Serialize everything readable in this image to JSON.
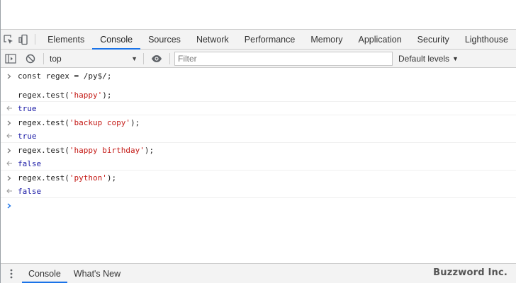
{
  "devtools": {
    "tabs": [
      "Elements",
      "Console",
      "Sources",
      "Network",
      "Performance",
      "Memory",
      "Application",
      "Security",
      "Lighthouse"
    ],
    "active_tab": "Console"
  },
  "toolbar": {
    "context_value": "top",
    "filter_placeholder": "Filter",
    "levels_label": "Default levels"
  },
  "console": {
    "input1_line1_code": "const regex = /py$/;",
    "input1_line2_prefix": "regex.test(",
    "input1_line2_arg": "'happy'",
    "input1_line2_suffix": ");",
    "result1": "true",
    "input2_prefix": "regex.test(",
    "input2_arg": "'backup copy'",
    "input2_suffix": ");",
    "result2": "true",
    "input3_prefix": "regex.test(",
    "input3_arg": "'happy birthday'",
    "input3_suffix": ");",
    "result3": "false",
    "input4_prefix": "regex.test(",
    "input4_arg": "'python'",
    "input4_suffix": ");",
    "result4": "false"
  },
  "drawer": {
    "tabs": [
      "Console",
      "What's New"
    ],
    "active_tab": "Console"
  },
  "watermark": "Buzzword Inc.",
  "colors": {
    "accent": "#1a73e8",
    "string": "#c41a16",
    "result": "#1a1aa6",
    "panel_bg": "#f3f3f3"
  }
}
